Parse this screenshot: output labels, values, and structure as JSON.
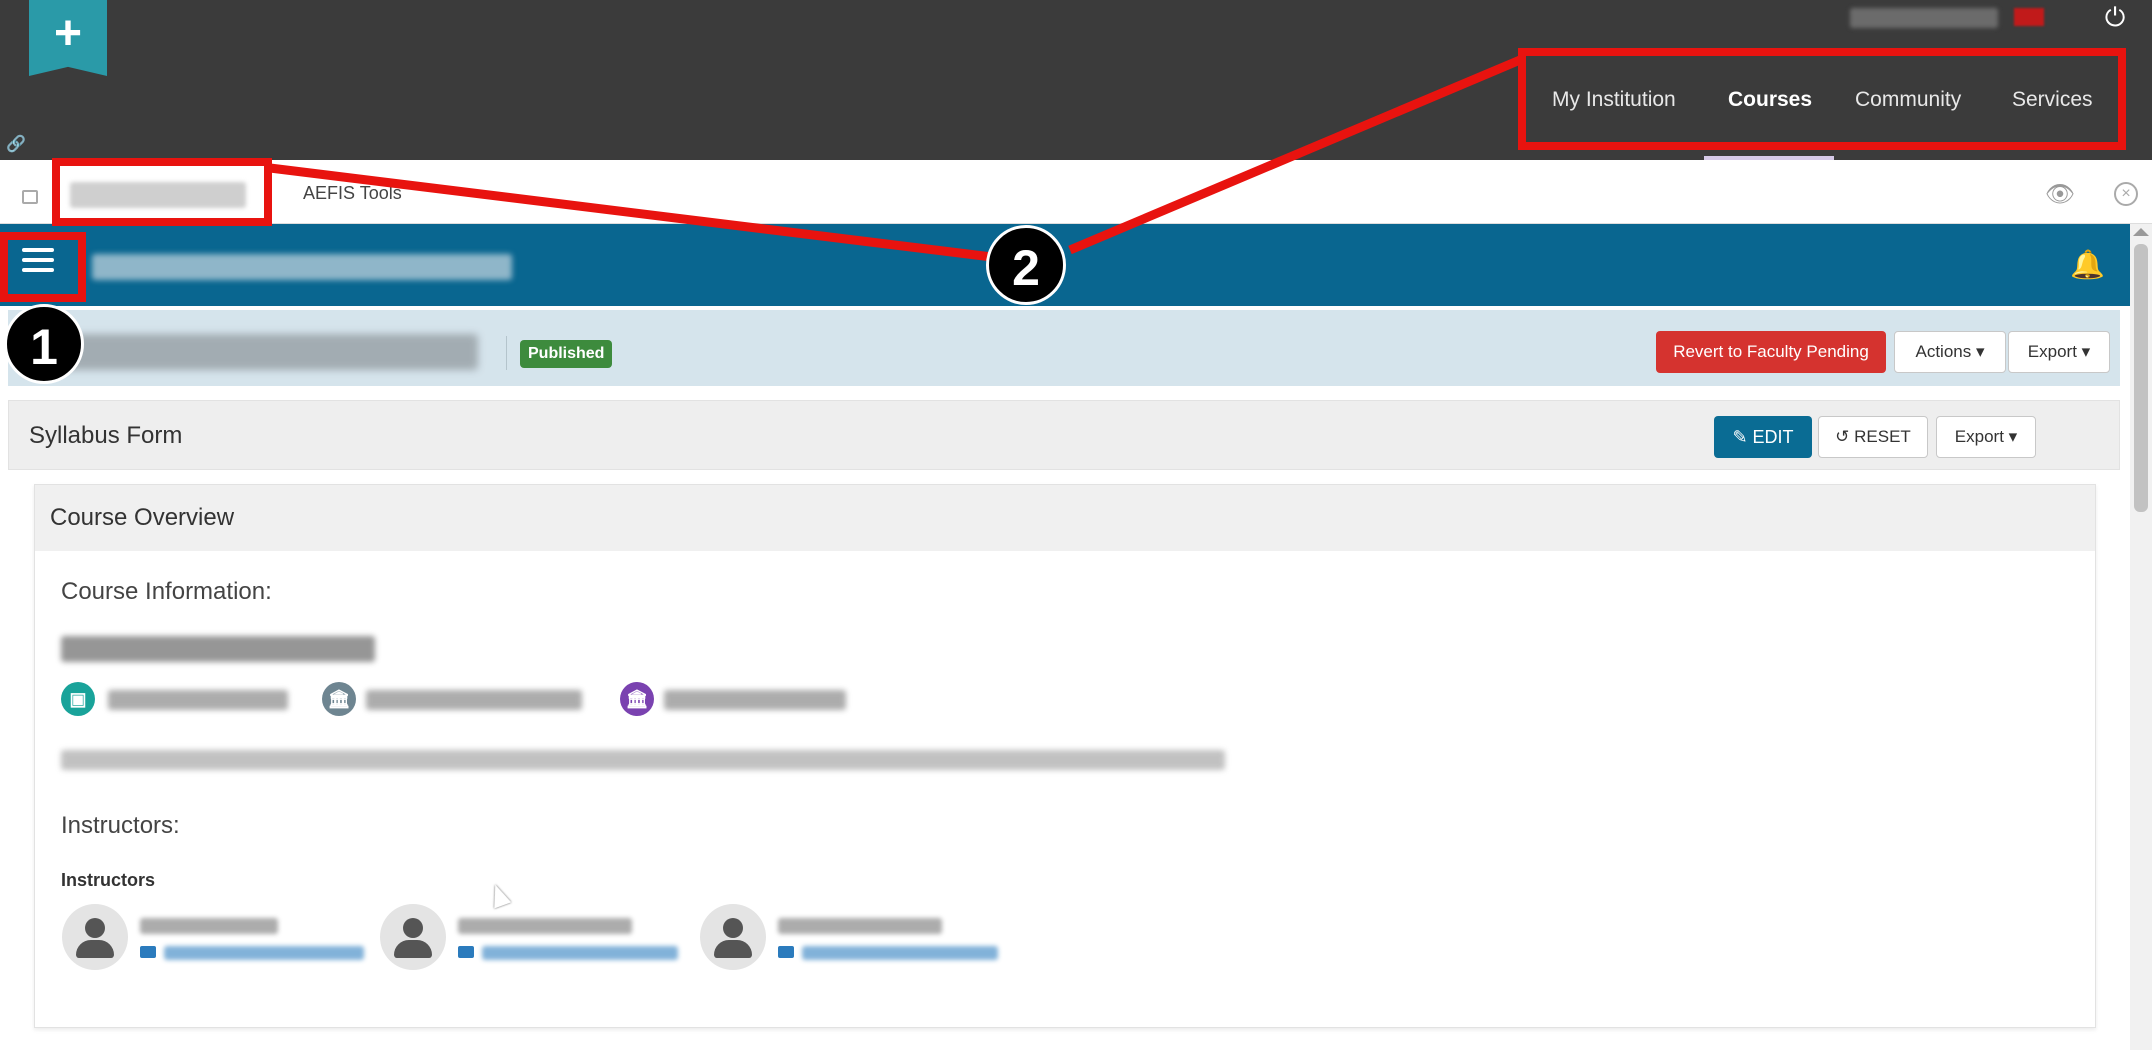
{
  "app": {
    "logo_symbol": "+",
    "power_symbol": "⏻",
    "pin_symbol": "🔗"
  },
  "top_nav": {
    "items": [
      {
        "label": "My Institution",
        "active": false
      },
      {
        "label": "Courses",
        "active": true
      },
      {
        "label": "Community",
        "active": false
      },
      {
        "label": "Services",
        "active": false
      }
    ]
  },
  "tabs": {
    "items": [
      {
        "label": "AEFIS Tools"
      }
    ],
    "eye_symbol": "👁",
    "close_symbol": "×"
  },
  "header": {
    "bell_symbol": "🔔"
  },
  "course": {
    "status_badge": "Published",
    "revert_button": "Revert to Faculty Pending",
    "actions_button": "Actions ▾",
    "export_button": "Export ▾"
  },
  "syllabus": {
    "title": "Syllabus Form",
    "edit_button": "✎ EDIT",
    "reset_button": "↺ RESET",
    "export_button": "Export ▾"
  },
  "overview": {
    "title": "Course Overview",
    "course_info_heading": "Course Information:",
    "instructors_heading": "Instructors:",
    "instructors_label": "Instructors",
    "meta_icons": [
      "▣",
      "🏛",
      "🏛"
    ]
  },
  "annotations": {
    "callout_1": "1",
    "callout_2": "2"
  },
  "colors": {
    "topbar": "#3b3b3b",
    "header_blue": "#096690",
    "published_green": "#3d8b3d",
    "revert_red": "#d5332f",
    "annotation_red": "#e8130f"
  }
}
